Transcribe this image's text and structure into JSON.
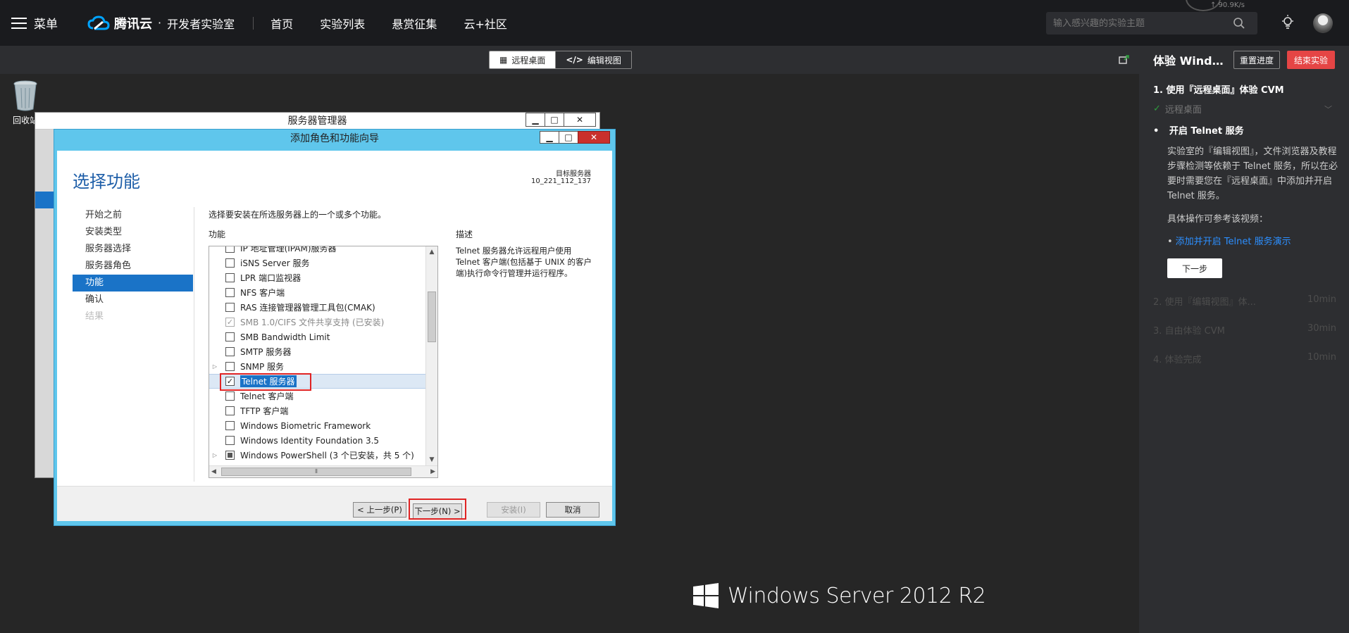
{
  "topbar": {
    "menu_label": "菜单",
    "logo_text": "腾讯云",
    "logo_dot": "·",
    "logo_sub": "开发者实验室",
    "nav": [
      "首页",
      "实验列表",
      "悬赏征集",
      "云+社区"
    ],
    "search_placeholder": "输入感兴趣的实验主题",
    "speed": "↑ 90.9K/s"
  },
  "toolbar": {
    "remote_desktop": "远程桌面",
    "edit_view": "编辑视图"
  },
  "desktop": {
    "recycle_bin": "回收站",
    "os_brand": "Windows Server 2012 R2"
  },
  "server_manager": {
    "title": "服务器管理器"
  },
  "wizard": {
    "title": "添加角色和功能向导",
    "heading": "选择功能",
    "target_label": "目标服务器",
    "target_value": "10_221_112_137",
    "nav": [
      {
        "label": "开始之前",
        "state": "normal"
      },
      {
        "label": "安装类型",
        "state": "normal"
      },
      {
        "label": "服务器选择",
        "state": "normal"
      },
      {
        "label": "服务器角色",
        "state": "normal"
      },
      {
        "label": "功能",
        "state": "active"
      },
      {
        "label": "确认",
        "state": "normal"
      },
      {
        "label": "结果",
        "state": "disabled"
      }
    ],
    "instruction": "选择要安装在所选服务器上的一个或多个功能。",
    "features_label": "功能",
    "description_label": "描述",
    "description": "Telnet 服务器允许远程用户使用 Telnet 客户端(包括基于 UNIX 的客户端)执行命令行管理并运行程序。",
    "features": [
      {
        "label": "IP 地址管理(IPAM)服务器",
        "checked": false
      },
      {
        "label": "iSNS Server 服务",
        "checked": false
      },
      {
        "label": "LPR 端口监视器",
        "checked": false
      },
      {
        "label": "NFS 客户端",
        "checked": false
      },
      {
        "label": "RAS 连接管理器管理工具包(CMAK)",
        "checked": false
      },
      {
        "label": "SMB 1.0/CIFS 文件共享支持 (已安装)",
        "checked": true,
        "disabled": true
      },
      {
        "label": "SMB Bandwidth Limit",
        "checked": false
      },
      {
        "label": "SMTP 服务器",
        "checked": false
      },
      {
        "label": "SNMP 服务",
        "checked": false,
        "expandable": true
      },
      {
        "label": "Telnet 服务器",
        "checked": true,
        "selected": true
      },
      {
        "label": "Telnet 客户端",
        "checked": false
      },
      {
        "label": "TFTP 客户端",
        "checked": false
      },
      {
        "label": "Windows Biometric Framework",
        "checked": false
      },
      {
        "label": "Windows Identity Foundation 3.5",
        "checked": false
      },
      {
        "label": "Windows PowerShell (3 个已安装，共 5 个)",
        "checked": false,
        "partial": true,
        "expandable": true
      }
    ],
    "buttons": {
      "prev": "< 上一步(P)",
      "next": "下一步(N) >",
      "install": "安装(I)",
      "cancel": "取消"
    }
  },
  "right_panel": {
    "title": "体验 Windows Server",
    "reset": "重置进度",
    "end": "结束实验",
    "step1_title": "1. 使用『远程桌面』体验 CVM",
    "sub1": "远程桌面",
    "sub2": "开启 Telnet 服务",
    "body": "实验室的『编辑视图』，文件浏览器及教程步骤检测等依赖于 Telnet 服务，所以在必要时需要您在『远程桌面』中添加并开启 Telnet 服务。",
    "ref": "具体操作可参考该视频：",
    "link": "添加并开启 Telnet 服务演示",
    "next": "下一步",
    "steps": [
      {
        "label": "2. 使用『编辑视图』体...",
        "time": "10min"
      },
      {
        "label": "3. 自由体验 CVM",
        "time": "30min"
      },
      {
        "label": "4. 体验完成",
        "time": "10min"
      }
    ]
  }
}
